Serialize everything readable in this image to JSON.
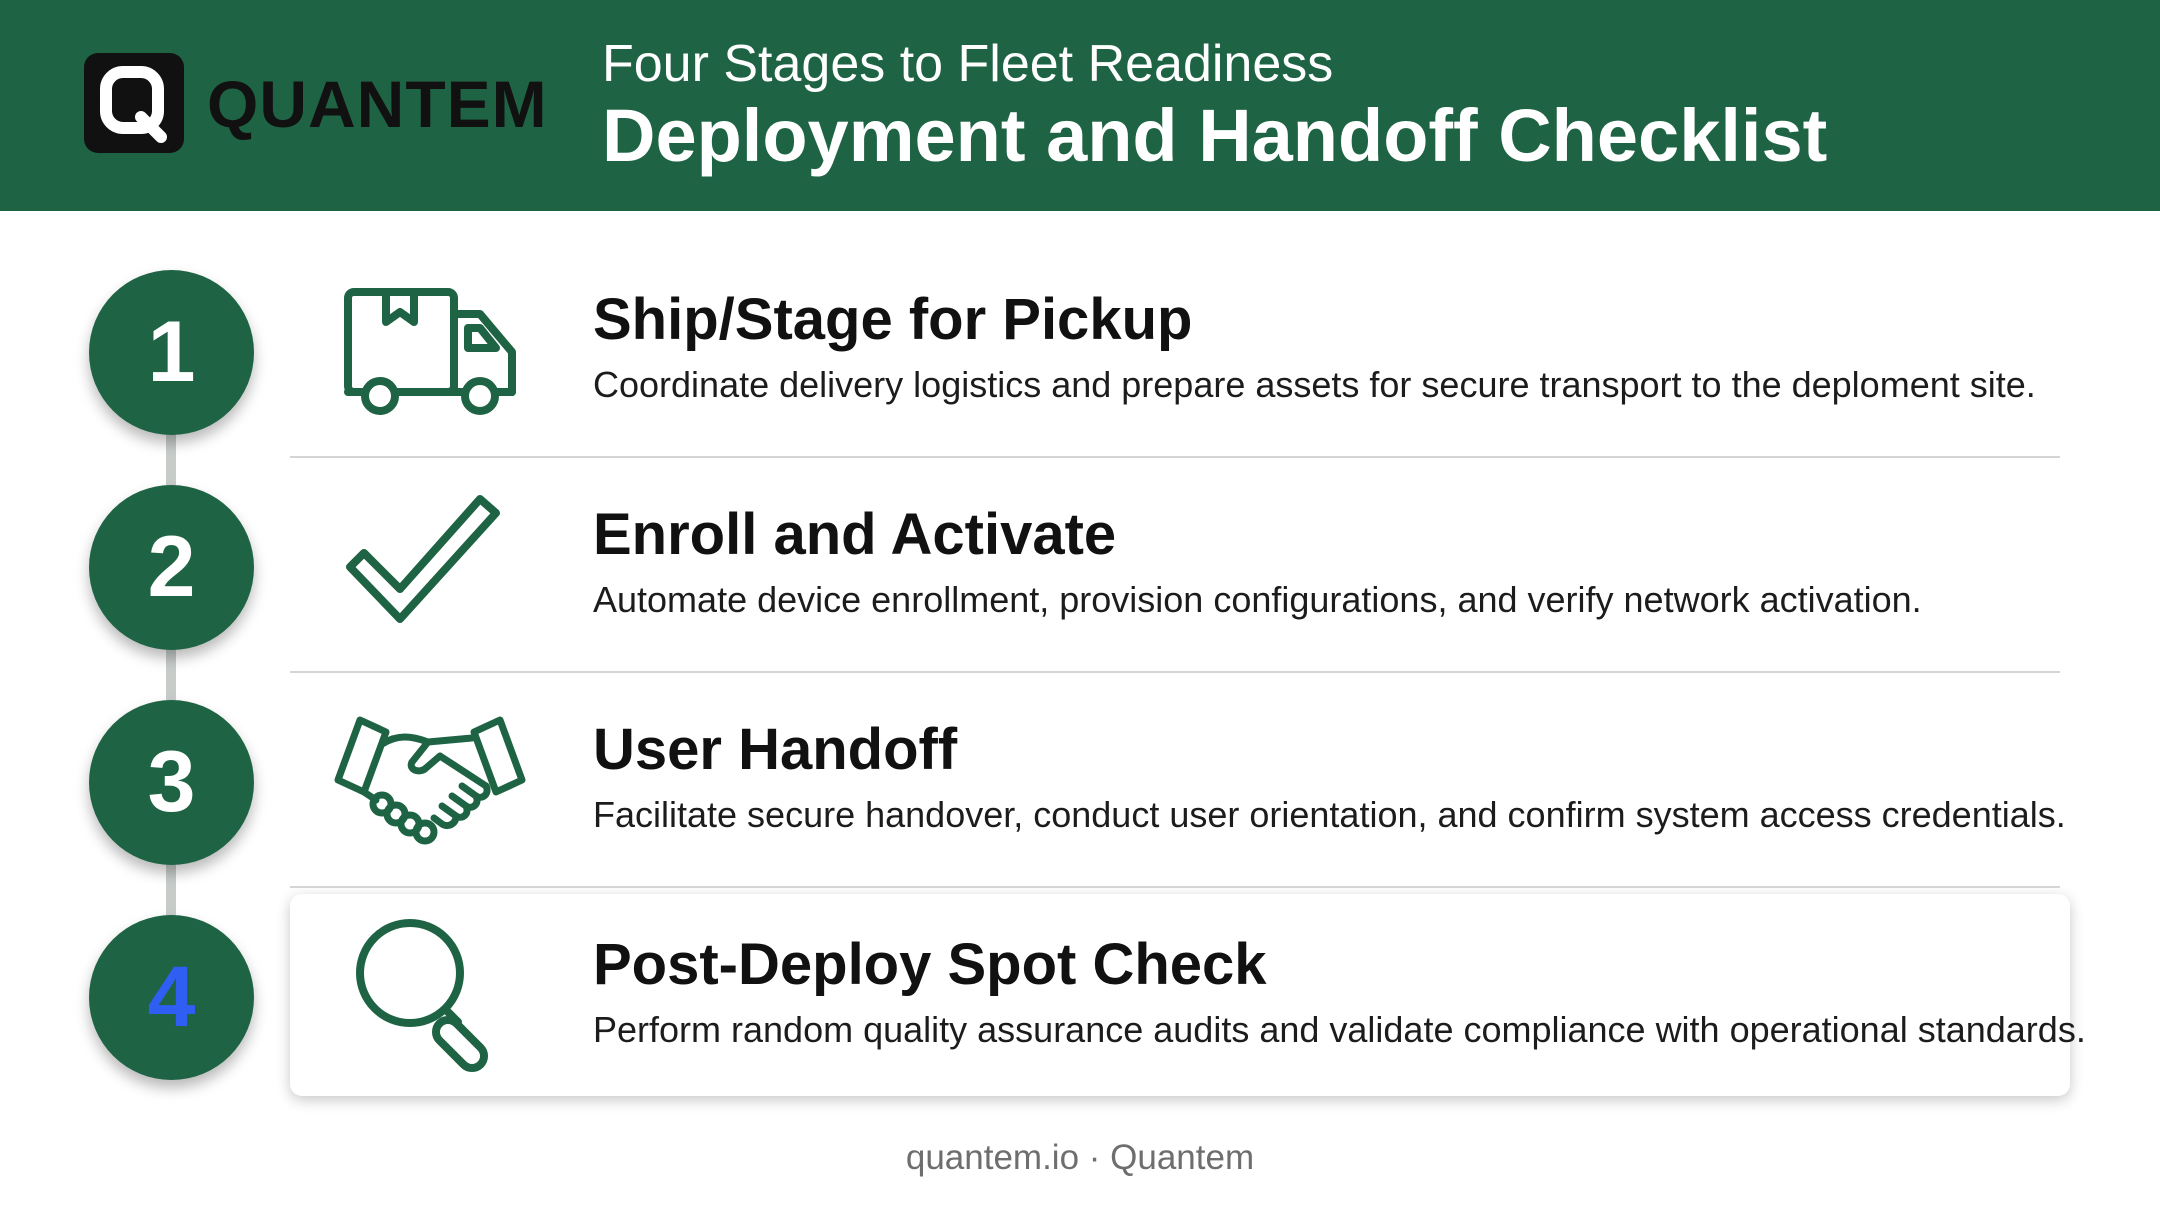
{
  "brand": {
    "logo_letter": "Q",
    "name": "QUANTEM"
  },
  "header": {
    "subtitle": "Four Stages to Fleet Readiness",
    "title": "Deployment and Handoff Checklist"
  },
  "steps": [
    {
      "number": "1",
      "icon": "delivery-truck-icon",
      "title": "Ship/Stage for Pickup",
      "description": "Coordinate delivery logistics and prepare assets for secure transport to the deploment site."
    },
    {
      "number": "2",
      "icon": "checkmark-icon",
      "title": "Enroll and Activate",
      "description": "Automate device enrollment, provision configurations, and verify network activation."
    },
    {
      "number": "3",
      "icon": "handshake-icon",
      "title": "User Handoff",
      "description": "Facilitate secure handover, conduct user orientation, and confirm system access credentials."
    },
    {
      "number": "4",
      "icon": "magnifying-glass-icon",
      "title": "Post-Deploy Spot Check",
      "description": "Perform random quality assurance audits and validate compliance with operational standards.",
      "highlighted": true
    }
  ],
  "footer": {
    "text": "quantem.io · Quantem"
  },
  "colors": {
    "brand_green": "#1e6444",
    "highlight_number": "#2f5ff2",
    "logo_dark": "#111111"
  }
}
